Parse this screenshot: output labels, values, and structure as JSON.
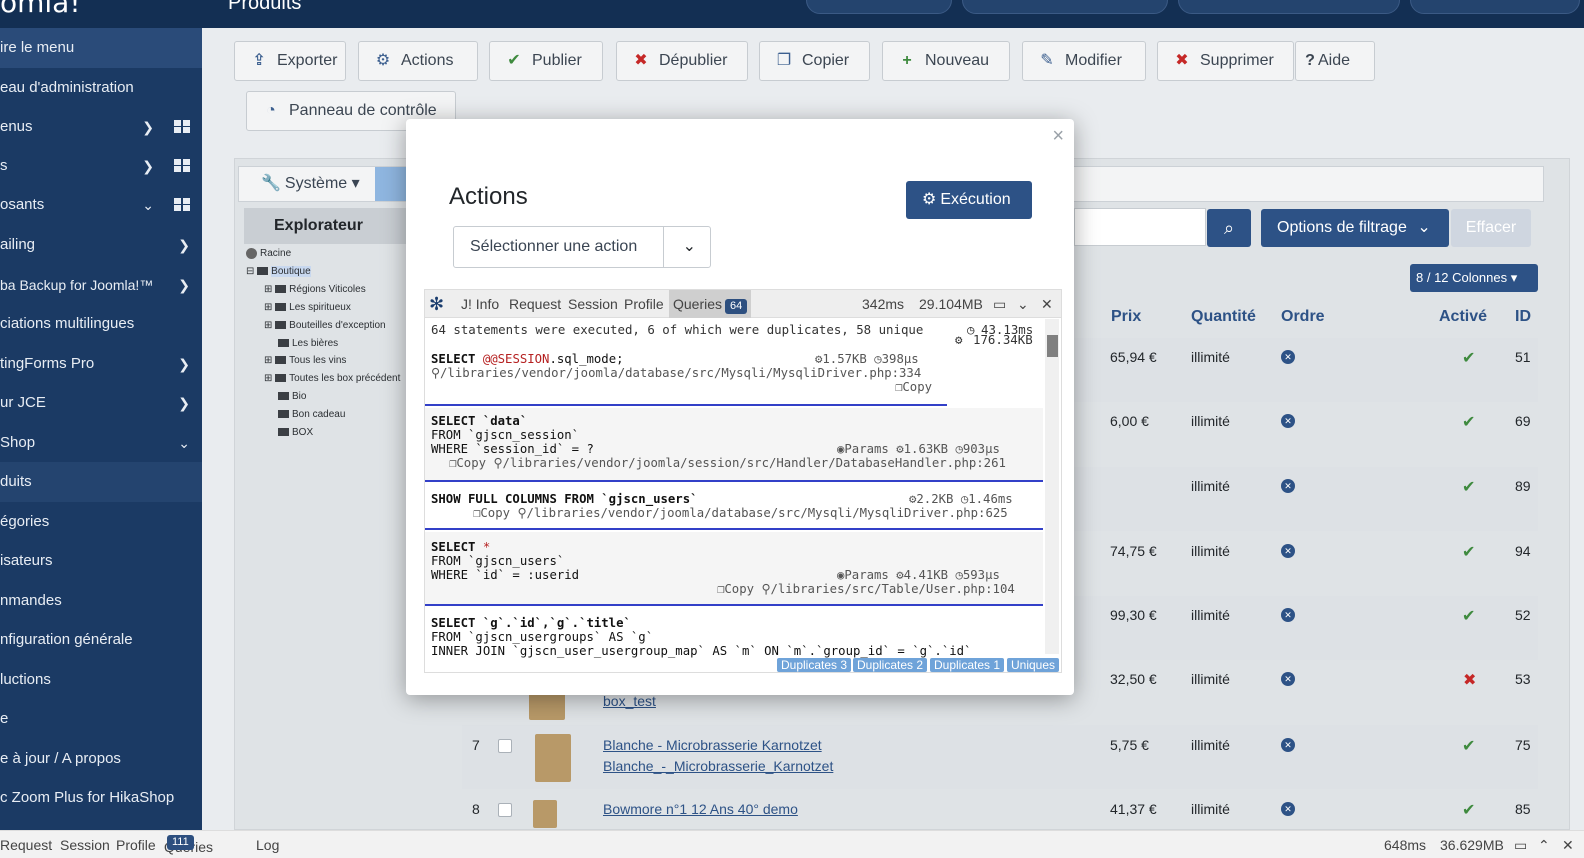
{
  "topbar": {
    "brand": "omla!",
    "title": "Produits"
  },
  "sidebar": {
    "items": [
      {
        "label": "ire le menu"
      },
      {
        "label": "eau d'administration"
      },
      {
        "label": "enus"
      },
      {
        "label": "s"
      },
      {
        "label": "osants"
      },
      {
        "label": "ailing"
      },
      {
        "label": "ba Backup for Joomla!™"
      },
      {
        "label": "ciations multilingues"
      },
      {
        "label": "tingForms Pro"
      },
      {
        "label": "ur JCE"
      },
      {
        "label": "Shop"
      },
      {
        "label": "duits"
      },
      {
        "label": "égories"
      },
      {
        "label": "isateurs"
      },
      {
        "label": "nmandes"
      },
      {
        "label": "nfiguration générale"
      },
      {
        "label": "luctions"
      },
      {
        "label": "e"
      },
      {
        "label": "e à jour / A propos"
      },
      {
        "label": "c Zoom Plus for HikaShop"
      }
    ]
  },
  "toolbar": {
    "exporter": "Exporter",
    "actions": "Actions",
    "publier": "Publier",
    "depublier": "Dépublier",
    "copier": "Copier",
    "nouveau": "Nouveau",
    "modifier": "Modifier",
    "supprimer": "Supprimer",
    "aide": "Aide",
    "panneau": "Panneau de contrôle"
  },
  "subbar": {
    "systeme": "Système"
  },
  "explorer": {
    "title": "Explorateur",
    "root": "Racine",
    "boutique": "Boutique",
    "nodes": [
      "Régions Viticoles",
      "Les spiritueux",
      "Bouteilles d'exception",
      "Les bières",
      "Tous les vins",
      "Toutes les box précédent",
      "Bio",
      "Bon cadeau",
      "BOX"
    ]
  },
  "filters": {
    "options": "Options de filtrage",
    "clear": "Effacer",
    "columns": "8 / 12  Colonnes"
  },
  "table": {
    "headers": {
      "prix": "Prix",
      "quantite": "Quantité",
      "ordre": "Ordre",
      "active": "Activé",
      "id": "ID"
    },
    "rows": [
      {
        "num": "",
        "name": "",
        "alias": "",
        "prix": "65,94 €",
        "qty": "illimité",
        "active": true,
        "id": "51"
      },
      {
        "num": "",
        "name": "",
        "alias": "",
        "prix": "6,00 €",
        "qty": "illimité",
        "active": true,
        "id": "69"
      },
      {
        "num": "",
        "name": "",
        "alias": "",
        "prix": "",
        "qty": "illimité",
        "active": true,
        "id": "89"
      },
      {
        "num": "",
        "name": "",
        "alias": "",
        "prix": "74,75 €",
        "qty": "illimité",
        "active": true,
        "id": "94"
      },
      {
        "num": "",
        "name": "",
        "alias": "",
        "prix": "99,30 €",
        "qty": "illimité",
        "active": true,
        "id": "52"
      },
      {
        "num": "",
        "name": "",
        "alias": "box_test",
        "prix": "32,50 €",
        "qty": "illimité",
        "active": false,
        "id": "53"
      },
      {
        "num": "7",
        "name": "Blanche - Microbrasserie Karnotzet",
        "alias": "Blanche_-_Microbrasserie_Karnotzet",
        "prix": "5,75 €",
        "qty": "illimité",
        "active": true,
        "id": "75"
      },
      {
        "num": "8",
        "name": "Bowmore n°1 12 Ans 40° demo",
        "alias": "",
        "prix": "41,37 €",
        "qty": "illimité",
        "active": true,
        "id": "85"
      }
    ]
  },
  "modal": {
    "title": "Actions",
    "exec": "Exécution",
    "select": "Sélectionner une action",
    "close": "×"
  },
  "debug": {
    "tabs": [
      "J! Info",
      "Request",
      "Session",
      "Profile",
      "Queries"
    ],
    "queries_count": "64",
    "time": "342ms",
    "memory": "29.104MB",
    "summary": "64 statements were executed, 6 of which were duplicates, 58 unique",
    "sum_time": "43.13ms",
    "sum_mem": "176.34KB",
    "q1": {
      "sql_a": "SELECT ",
      "sql_b": "@@SESSION",
      "sql_c": ".sql_mode;",
      "mem": "1.57KB",
      "time": "398µs",
      "path": "/libraries/vendor/joomla/database/src/Mysqli/MysqliDriver.php:334",
      "copy": "Copy"
    },
    "q2": {
      "l1": "SELECT `data`",
      "l2": "FROM `gjscn_session`",
      "l3": "WHERE `session_id` = ?",
      "params": "Params",
      "mem": "1.63KB",
      "time": "903µs",
      "copy": "Copy",
      "path": "/libraries/vendor/joomla/session/src/Handler/DatabaseHandler.php:261"
    },
    "q3": {
      "l1": "SHOW FULL COLUMNS FROM `gjscn_users`",
      "mem": "2.2KB",
      "time": "1.46ms",
      "copy": "Copy",
      "path": "/libraries/vendor/joomla/database/src/Mysqli/MysqliDriver.php:625"
    },
    "q4": {
      "l1": "SELECT *",
      "l2": "FROM `gjscn_users`",
      "l3": "WHERE `id` = :userid",
      "params": "Params",
      "mem": "4.41KB",
      "time": "593µs",
      "copy": "Copy",
      "path": "/libraries/src/Table/User.php:104"
    },
    "q5": {
      "l1": "SELECT `g`.`id`,`g`.`title`",
      "l2": "FROM `gjscn_usergroups` AS `g`",
      "l3": "INNER JOIN `gjscn_user_usergroup_map` AS `m` ON `m`.`group_id` = `g`.`id`"
    },
    "filters": [
      "Duplicates 3",
      "Duplicates 2",
      "Duplicates 1",
      "Uniques"
    ]
  },
  "bottombar": {
    "tabs": [
      "Request",
      "Session",
      "Profile",
      "Queries",
      "Log"
    ],
    "queries_count": "111",
    "time": "648ms",
    "memory": "36.629MB"
  }
}
